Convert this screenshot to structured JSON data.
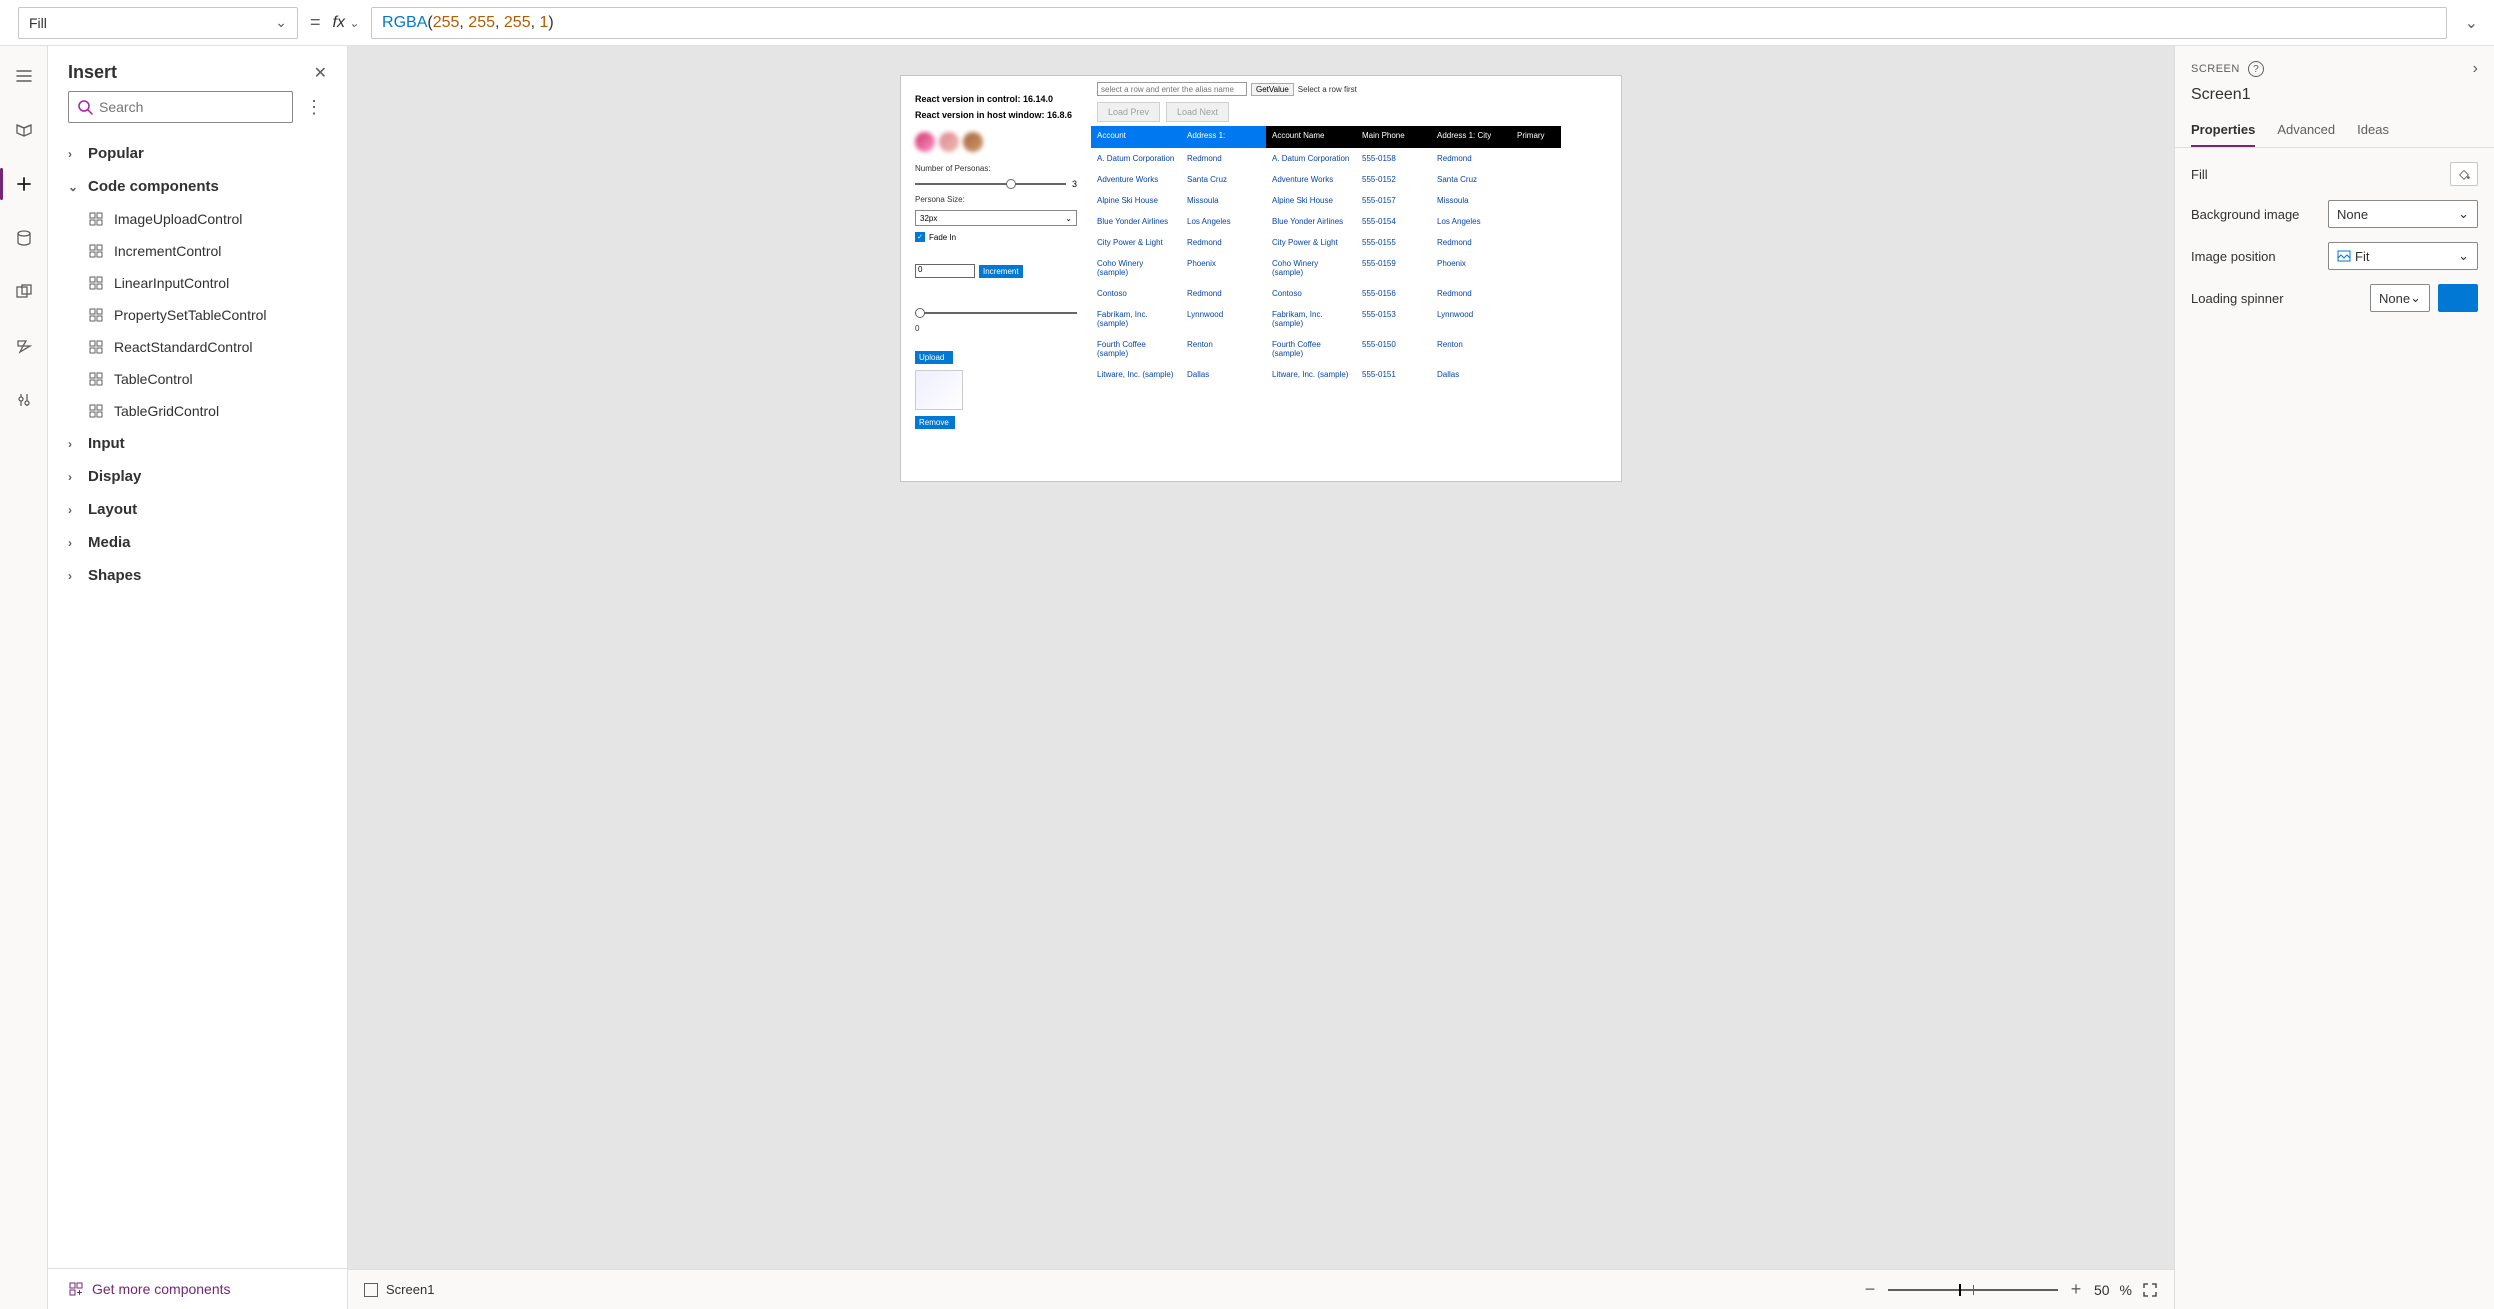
{
  "topbar": {
    "property": "Fill",
    "formula_fn": "RGBA",
    "formula_args_display": "(255, 255, 255, 1)"
  },
  "insertPanel": {
    "title": "Insert",
    "searchPlaceholder": "Search",
    "groups": {
      "popular": "Popular",
      "codeComponents": "Code components",
      "input": "Input",
      "display": "Display",
      "layout": "Layout",
      "media": "Media",
      "shapes": "Shapes"
    },
    "codeItems": [
      "ImageUploadControl",
      "IncrementControl",
      "LinearInputControl",
      "PropertySetTableControl",
      "ReactStandardControl",
      "TableControl",
      "TableGridControl"
    ],
    "getMore": "Get more components"
  },
  "canvas": {
    "reactControl": "React version in control: 16.14.0",
    "reactHost": "React version in host window: 16.8.6",
    "numPersonasLabel": "Number of Personas:",
    "numPersonasVal": "3",
    "personaSizeLabel": "Persona Size:",
    "personaSize": "32px",
    "fadeIn": "Fade In",
    "numInputVal": "0",
    "increment": "Increment",
    "sliderVal": "0",
    "upload": "Upload",
    "remove": "Remove",
    "aliasPlaceholder": "select a row and enter the alias name",
    "getValue": "GetValue",
    "selectRowHint": "Select a row first",
    "loadPrev": "Load Prev",
    "loadNext": "Load Next",
    "cols": [
      "Account",
      "Address 1:",
      "Account Name",
      "Main Phone",
      "Address 1: City",
      "Primary"
    ],
    "rows": [
      [
        "A. Datum Corporation",
        "Redmond",
        "A. Datum Corporation",
        "555-0158",
        "Redmond"
      ],
      [
        "Adventure Works",
        "Santa Cruz",
        "Adventure Works",
        "555-0152",
        "Santa Cruz"
      ],
      [
        "Alpine Ski House",
        "Missoula",
        "Alpine Ski House",
        "555-0157",
        "Missoula"
      ],
      [
        "Blue Yonder Airlines",
        "Los Angeles",
        "Blue Yonder Airlines",
        "555-0154",
        "Los Angeles"
      ],
      [
        "City Power & Light",
        "Redmond",
        "City Power & Light",
        "555-0155",
        "Redmond"
      ],
      [
        "Coho Winery (sample)",
        "Phoenix",
        "Coho Winery (sample)",
        "555-0159",
        "Phoenix"
      ],
      [
        "Contoso",
        "Redmond",
        "Contoso",
        "555-0156",
        "Redmond"
      ],
      [
        "Fabrikam, Inc. (sample)",
        "Lynnwood",
        "Fabrikam, Inc. (sample)",
        "555-0153",
        "Lynnwood"
      ],
      [
        "Fourth Coffee (sample)",
        "Renton",
        "Fourth Coffee (sample)",
        "555-0150",
        "Renton"
      ],
      [
        "Litware, Inc. (sample)",
        "Dallas",
        "Litware, Inc. (sample)",
        "555-0151",
        "Dallas"
      ]
    ]
  },
  "statusBar": {
    "screenName": "Screen1",
    "zoomLabel": "50",
    "zoomPct": "%"
  },
  "rightPanel": {
    "screenTag": "SCREEN",
    "name": "Screen1",
    "tabs": {
      "properties": "Properties",
      "advanced": "Advanced",
      "ideas": "Ideas"
    },
    "props": {
      "fill": "Fill",
      "bgImage": "Background image",
      "bgImageVal": "None",
      "imgPos": "Image position",
      "imgPosVal": "Fit",
      "spinner": "Loading spinner",
      "spinnerVal": "None"
    }
  }
}
